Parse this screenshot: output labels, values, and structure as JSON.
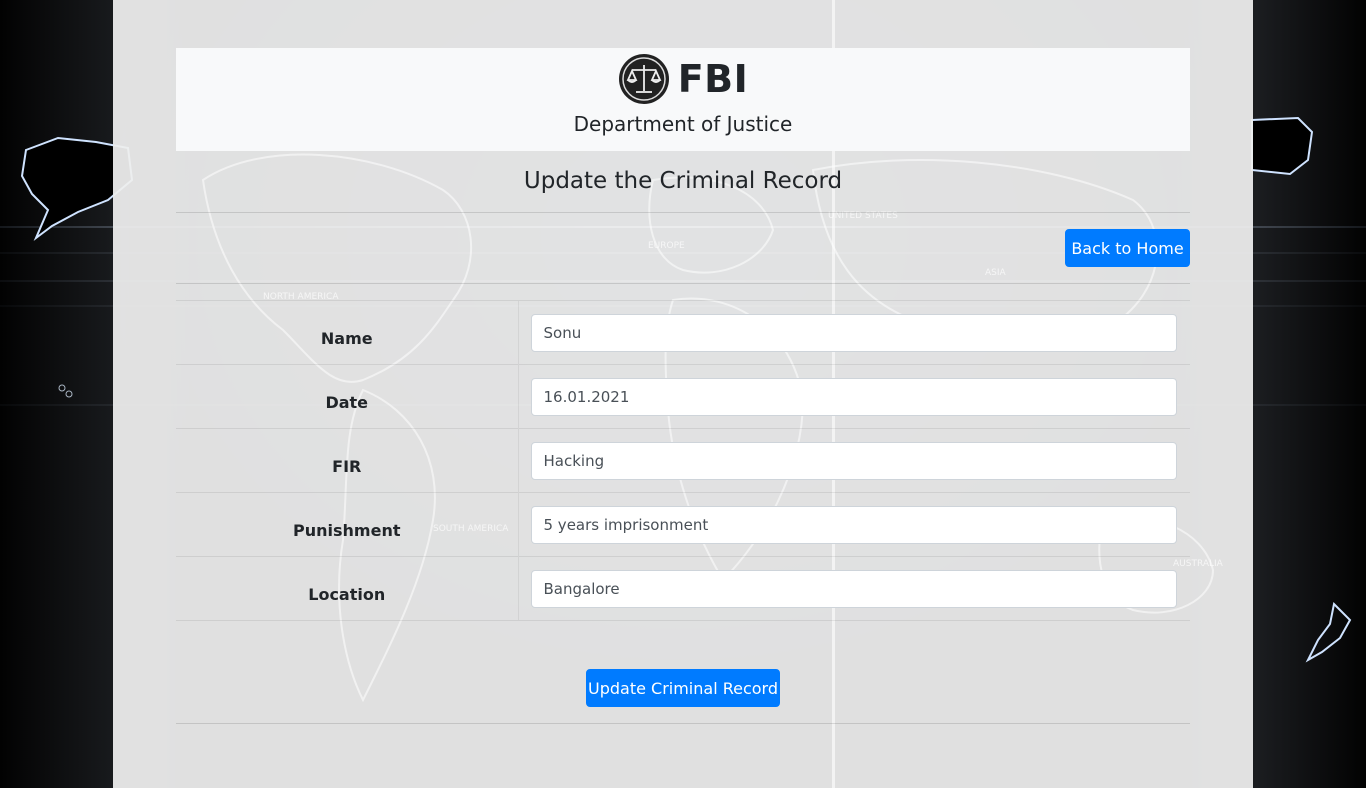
{
  "header": {
    "brand": "FBI",
    "department": "Department of Justice"
  },
  "page": {
    "title": "Update the Criminal Record"
  },
  "buttons": {
    "back_home": "Back to Home",
    "submit": "Update Criminal Record"
  },
  "form": {
    "fields": [
      {
        "label": "Name",
        "value": "Sonu"
      },
      {
        "label": "Date",
        "value": "16.01.2021"
      },
      {
        "label": "FIR",
        "value": "Hacking"
      },
      {
        "label": "Punishment",
        "value": "5 years imprisonment"
      },
      {
        "label": "Location",
        "value": "Bangalore"
      }
    ]
  },
  "map_labels": {
    "north_america": "NORTH AMERICA",
    "south_america": "SOUTH AMERICA",
    "europe": "EUROPE",
    "asia": "ASIA",
    "australia": "AUSTRALIA",
    "united_states": "UNITED STATES"
  },
  "colors": {
    "primary": "#007bff",
    "header_bg": "#f8f9fa",
    "panel_bg": "#eeeeee"
  }
}
